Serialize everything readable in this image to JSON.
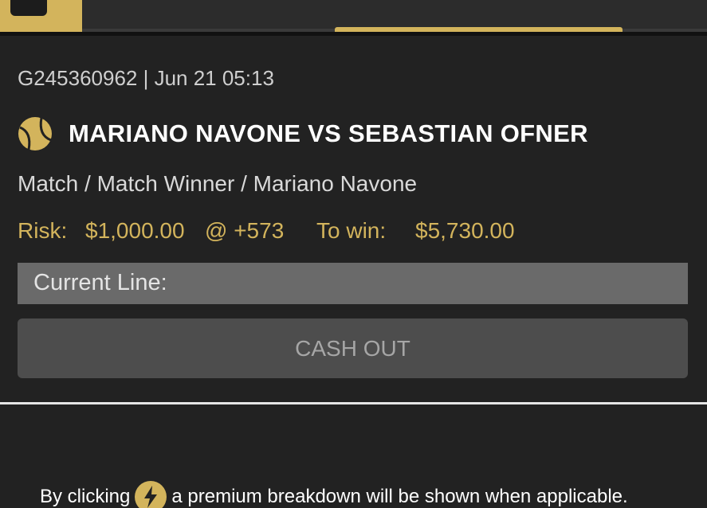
{
  "bet": {
    "meta": "G245360962 | Jun 21 05:13",
    "sport_icon": "tennis-ball-icon",
    "title": "MARIANO NAVONE VS SEBASTIAN OFNER",
    "market": "Match / Match Winner / Mariano Navone",
    "risk_label": "Risk:",
    "risk_amount": "$1,000.00",
    "odds": "@ +573",
    "to_win_label": "To win:",
    "to_win_amount": "$5,730.00"
  },
  "current_line": {
    "label": "Current Line:"
  },
  "cashout": {
    "label": "CASH OUT"
  },
  "footer": {
    "text_before": "By clicking",
    "icon": "lightning-bolt-icon",
    "text_after": "a premium breakdown will be shown when applicable."
  },
  "colors": {
    "background": "#222222",
    "accent_gold": "#d3b45c",
    "current_line_bg": "#6a6a6a",
    "cashout_bg": "#4d4d4d"
  }
}
